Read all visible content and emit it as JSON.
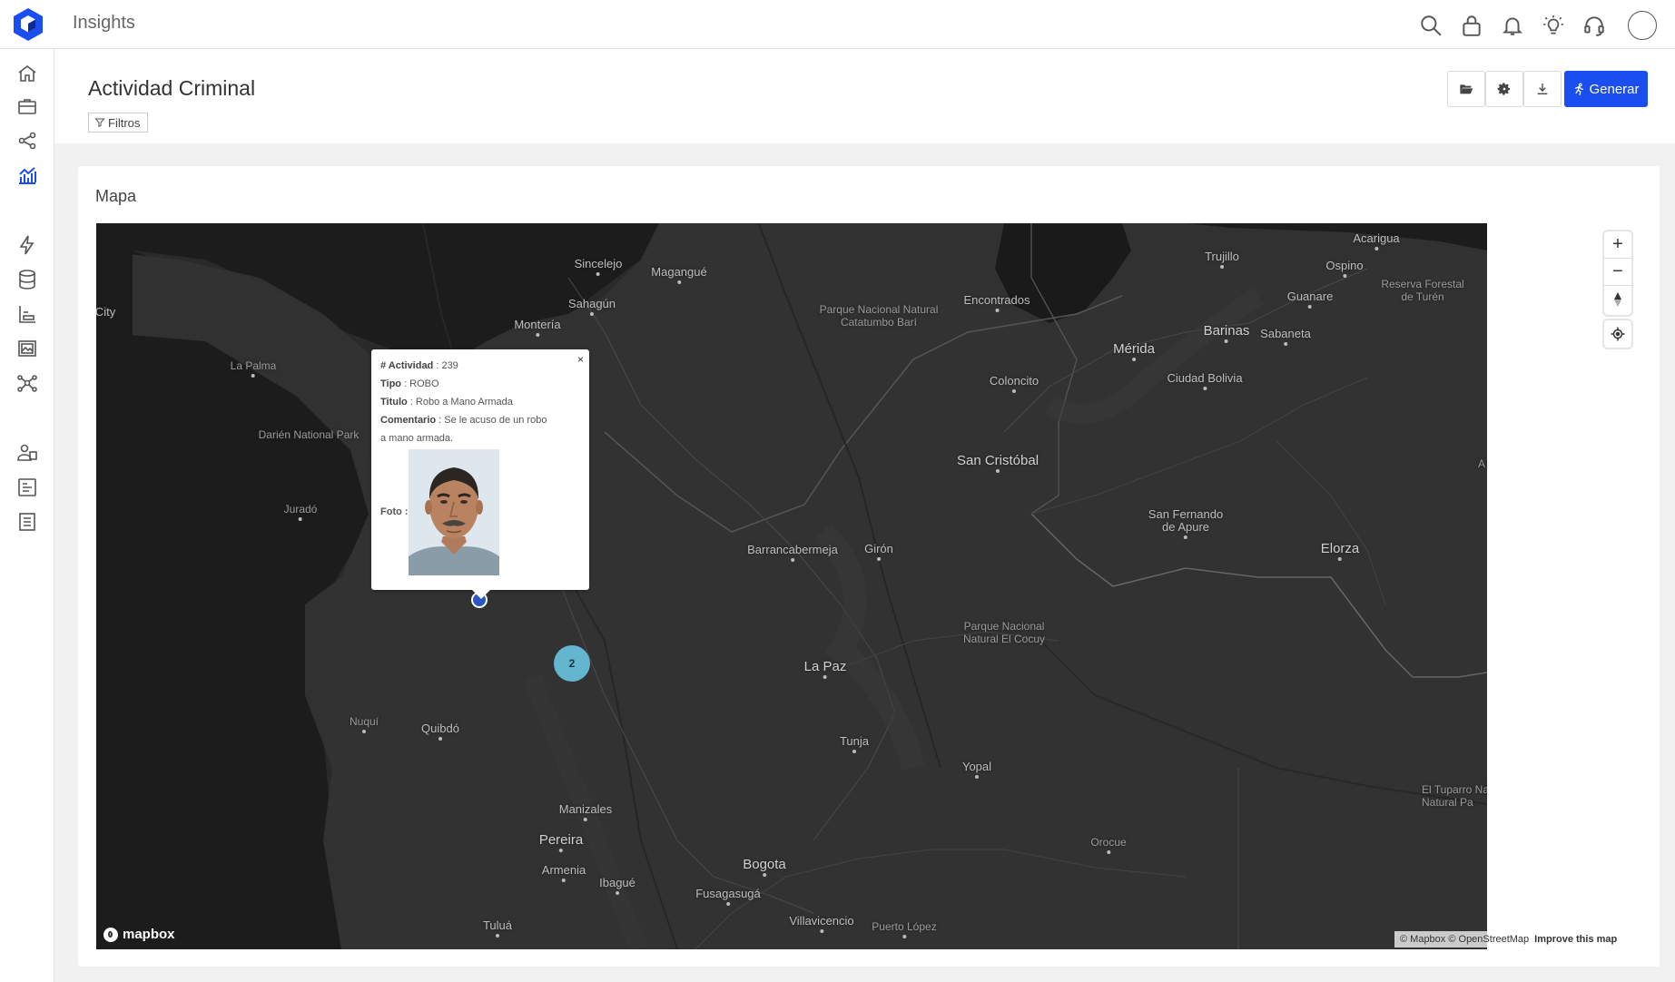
{
  "app": {
    "title": "Insights"
  },
  "topbar": {
    "icons": [
      "search-icon",
      "lock-icon",
      "bell-icon",
      "lightbulb-icon",
      "headset-icon",
      "avatar"
    ]
  },
  "sidebar": {
    "items": [
      "home-icon",
      "briefcase-icon",
      "share-icon",
      "analytics-icon",
      "bolt-icon",
      "database-icon",
      "chart-axis-icon",
      "gallery-icon",
      "network-icon",
      "users-icon",
      "form-icon",
      "document-icon"
    ]
  },
  "page": {
    "title": "Actividad Criminal",
    "filter_label": "Filtros",
    "buttons": {
      "open": "folder-open-icon",
      "settings": "gear-icon",
      "download": "download-icon",
      "generate": "Generar"
    }
  },
  "card": {
    "title": "Mapa"
  },
  "map": {
    "places": [
      {
        "name": "Sincelejo",
        "cls": ""
      },
      {
        "name": "Magangué",
        "cls": ""
      },
      {
        "name": "Sahagún",
        "cls": ""
      },
      {
        "name": "Montería",
        "cls": ""
      },
      {
        "name": "La Palma",
        "cls": "small"
      },
      {
        "name": "Darién National Park",
        "cls": "small"
      },
      {
        "name": "Juradó",
        "cls": "small"
      },
      {
        "name": "City",
        "cls": ""
      },
      {
        "name": "Parque Nacional Natural\nCatatumbo Barí",
        "cls": "small"
      },
      {
        "name": "Encontrados",
        "cls": ""
      },
      {
        "name": "Acarigua",
        "cls": ""
      },
      {
        "name": "Trujillo",
        "cls": ""
      },
      {
        "name": "Ospino",
        "cls": ""
      },
      {
        "name": "Reserva Forestal\nde Turén",
        "cls": "small"
      },
      {
        "name": "Guanare",
        "cls": ""
      },
      {
        "name": "Barinas",
        "cls": "big"
      },
      {
        "name": "Sabaneta",
        "cls": ""
      },
      {
        "name": "Mérida",
        "cls": "big"
      },
      {
        "name": "Ciudad Bolivia",
        "cls": ""
      },
      {
        "name": "Coloncito",
        "cls": ""
      },
      {
        "name": "San Cristóbal",
        "cls": "big"
      },
      {
        "name": "San Fernando\nde Apure",
        "cls": ""
      },
      {
        "name": "Elorza",
        "cls": "big"
      },
      {
        "name": "Barrancabermeja",
        "cls": ""
      },
      {
        "name": "Girón",
        "cls": ""
      },
      {
        "name": "Parque Nacional\nNatural El Cocuy",
        "cls": "small"
      },
      {
        "name": "La Paz",
        "cls": "big"
      },
      {
        "name": "Tunja",
        "cls": ""
      },
      {
        "name": "Yopal",
        "cls": ""
      },
      {
        "name": "El Tuparro Na\nNatural Pa",
        "cls": "small"
      },
      {
        "name": "Nuquí",
        "cls": "small"
      },
      {
        "name": "Quibdó",
        "cls": ""
      },
      {
        "name": "Manizales",
        "cls": ""
      },
      {
        "name": "Pereira",
        "cls": "big"
      },
      {
        "name": "Armenia",
        "cls": ""
      },
      {
        "name": "Ibagué",
        "cls": ""
      },
      {
        "name": "Bogota",
        "cls": "big"
      },
      {
        "name": "Orocue",
        "cls": "small"
      },
      {
        "name": "Fusagasugá",
        "cls": ""
      },
      {
        "name": "Villavicencio",
        "cls": ""
      },
      {
        "name": "Puerto López",
        "cls": "small"
      },
      {
        "name": "Tuluá",
        "cls": ""
      },
      {
        "name": "A",
        "cls": "small"
      }
    ],
    "cluster_count": "2",
    "logo_text": "mapbox",
    "attribution": "© Mapbox © OpenStreetMap",
    "improve_link": "Improve this map",
    "zoom_in": "+",
    "zoom_out": "−"
  },
  "popup": {
    "close": "×",
    "actividad_label": "# Actividad",
    "actividad_value": " : 239",
    "tipo_label": "Tipo",
    "tipo_value": " : ROBO",
    "titulo_label": "Titulo",
    "titulo_value": " : Robo a Mano Armada",
    "comentario_label": "Comentario",
    "comentario_value": " : Se le acuso de un robo a mano armada.",
    "foto_label": "Foto :"
  }
}
